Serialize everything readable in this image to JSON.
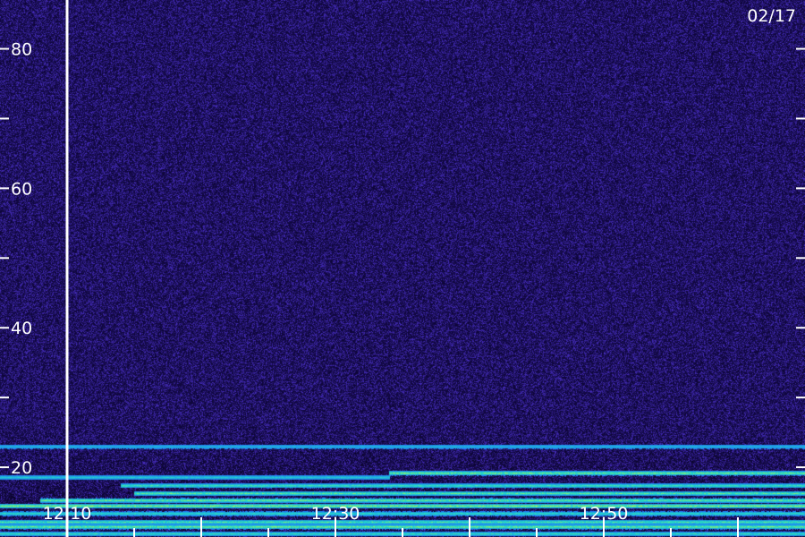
{
  "chart_data": {
    "type": "heatmap",
    "date_label": "02/17",
    "y_ticks": [
      {
        "value": 80,
        "label": "80"
      },
      {
        "value": 70,
        "label": ""
      },
      {
        "value": 60,
        "label": "60"
      },
      {
        "value": 50,
        "label": ""
      },
      {
        "value": 40,
        "label": "40"
      },
      {
        "value": 30,
        "label": ""
      },
      {
        "value": 20,
        "label": "20"
      }
    ],
    "ylim": [
      10,
      87
    ],
    "x_range_minutes": [
      "12:05",
      "13:05"
    ],
    "x_labels": [
      {
        "time": "12:10",
        "label": "12:10"
      },
      {
        "time": "12:30",
        "label": "12:30"
      },
      {
        "time": "12:50",
        "label": "12:50"
      }
    ],
    "x_minor_step_minutes": 5,
    "marker_time": "12:10",
    "bands": [
      {
        "freq": 23.0,
        "start": "12:05",
        "end": "13:05",
        "intensity": 0.45
      },
      {
        "freq": 19.2,
        "start": "12:34",
        "end": "13:05",
        "intensity": 0.95
      },
      {
        "freq": 18.6,
        "start": "12:05",
        "end": "12:34",
        "intensity": 0.55
      },
      {
        "freq": 17.4,
        "start": "12:14",
        "end": "13:05",
        "intensity": 0.75
      },
      {
        "freq": 16.3,
        "start": "12:15",
        "end": "13:05",
        "intensity": 0.85
      },
      {
        "freq": 15.3,
        "start": "12:08",
        "end": "13:05",
        "intensity": 0.9
      },
      {
        "freq": 14.5,
        "start": "12:05",
        "end": "13:05",
        "intensity": 1.0
      },
      {
        "freq": 13.4,
        "start": "12:05",
        "end": "13:05",
        "intensity": 0.7
      },
      {
        "freq": 12.2,
        "start": "12:05",
        "end": "13:05",
        "intensity": 0.8
      },
      {
        "freq": 11.5,
        "start": "12:05",
        "end": "13:05",
        "intensity": 0.95
      },
      {
        "freq": 10.5,
        "start": "12:05",
        "end": "13:05",
        "intensity": 0.7
      }
    ],
    "colors": {
      "background": "#1c0c6b",
      "noise_low": "#0a0330",
      "noise_high": "#4a30c8",
      "band_low": "#1e6cff",
      "band_mid": "#22d8c8",
      "band_high": "#d8ff30",
      "axis": "#ffffff"
    }
  }
}
